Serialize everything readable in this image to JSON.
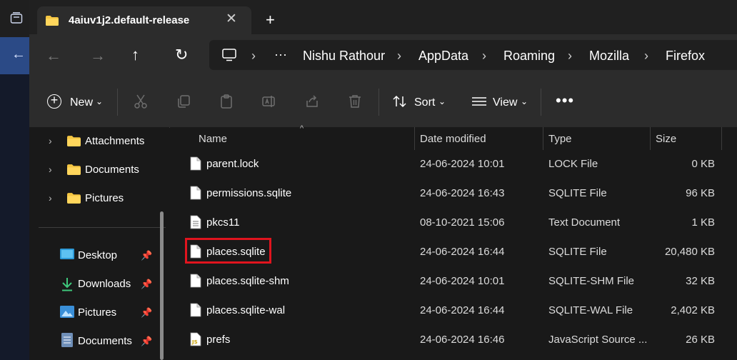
{
  "window": {
    "tab_title": "4aiuv1j2.default-release",
    "tab_close": "✕",
    "new_tab": "+"
  },
  "nav": {
    "back": "←",
    "forward": "→",
    "up": "↑",
    "refresh": "↻"
  },
  "breadcrumb": {
    "more": "···",
    "separator": "›",
    "items": [
      "Nishu Rathour",
      "AppData",
      "Roaming",
      "Mozilla",
      "Firefox"
    ]
  },
  "toolbar": {
    "new_label": "New",
    "new_plus": "+",
    "chevron": "⌄",
    "sort_label": "Sort",
    "view_label": "View",
    "more": "•••"
  },
  "sidebar": {
    "expand_chevron": "›",
    "pin": "📌",
    "folders": [
      "Attachments",
      "Documents",
      "Pictures"
    ],
    "quick_access": [
      "Desktop",
      "Downloads",
      "Pictures",
      "Documents"
    ]
  },
  "columns": {
    "name": "Name",
    "date": "Date modified",
    "type": "Type",
    "size": "Size",
    "sort_caret": "^"
  },
  "files": [
    {
      "name": "parent.lock",
      "date": "24-06-2024 10:01",
      "type": "LOCK File",
      "size": "0 KB",
      "icon": "file-icon"
    },
    {
      "name": "permissions.sqlite",
      "date": "24-06-2024 16:43",
      "type": "SQLITE File",
      "size": "96 KB",
      "icon": "file-icon"
    },
    {
      "name": "pkcs11",
      "date": "08-10-2021 15:06",
      "type": "Text Document",
      "size": "1 KB",
      "icon": "text-file-icon"
    },
    {
      "name": "places.sqlite",
      "date": "24-06-2024 16:44",
      "type": "SQLITE File",
      "size": "20,480 KB",
      "icon": "file-icon",
      "highlighted": true
    },
    {
      "name": "places.sqlite-shm",
      "date": "24-06-2024 10:01",
      "type": "SQLITE-SHM File",
      "size": "32 KB",
      "icon": "file-icon"
    },
    {
      "name": "places.sqlite-wal",
      "date": "24-06-2024 16:44",
      "type": "SQLITE-WAL File",
      "size": "2,402 KB",
      "icon": "file-icon"
    },
    {
      "name": "prefs",
      "date": "24-06-2024 16:46",
      "type": "JavaScript Source ...",
      "size": "26 KB",
      "icon": "js-file-icon"
    }
  ],
  "colors": {
    "accent_highlight": "#e0141e",
    "folder_yellow": "#f4c542",
    "background": "#191919",
    "toolbar": "#2c2c2c"
  }
}
